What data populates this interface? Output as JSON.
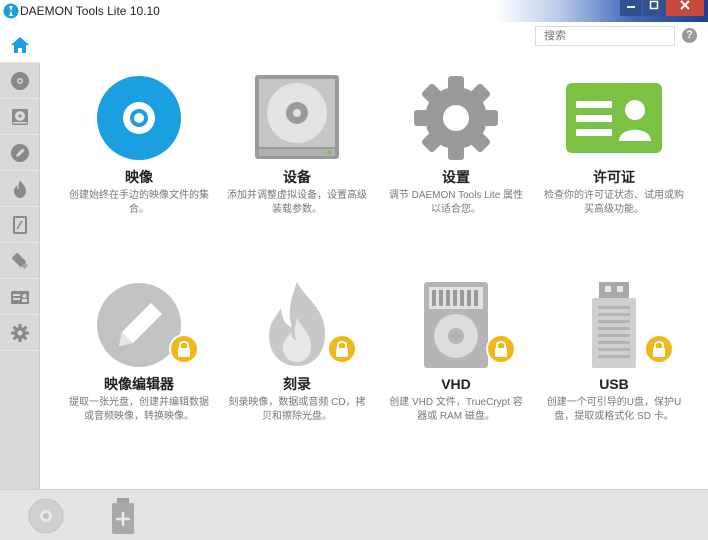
{
  "window": {
    "title": "DAEMON Tools Lite 10.10"
  },
  "search": {
    "placeholder": "搜索"
  },
  "help": {
    "symbol": "?"
  },
  "colors": {
    "accent_blue": "#1a9fe0",
    "lock_yellow": "#f1b81c",
    "license_green": "#7bc143",
    "icon_gray": "#9a9a9a",
    "sidebar_bg": "#d9d9d9"
  },
  "sidebar": {
    "items": [
      {
        "name": "home",
        "icon": "home-icon",
        "active": true
      },
      {
        "name": "images",
        "icon": "disc-icon"
      },
      {
        "name": "virtual-drive",
        "icon": "drive-icon"
      },
      {
        "name": "edit-image",
        "icon": "pencil-icon"
      },
      {
        "name": "burn",
        "icon": "flame-icon"
      },
      {
        "name": "vhd",
        "icon": "vhd-icon"
      },
      {
        "name": "usb",
        "icon": "usb-icon"
      },
      {
        "name": "license",
        "icon": "license-icon"
      },
      {
        "name": "settings",
        "icon": "gear-icon"
      }
    ]
  },
  "tiles": [
    {
      "id": "image",
      "label": "映像",
      "desc": "创建始终在手边的映像文件的集合。",
      "locked": false,
      "icon": "disc-icon"
    },
    {
      "id": "device",
      "label": "设备",
      "desc": "添加并调整虚拟设备，设置高级装载参数。",
      "locked": false,
      "icon": "drive-icon"
    },
    {
      "id": "settings",
      "label": "设置",
      "desc": "调节 DAEMON Tools Lite 属性以适合您。",
      "locked": false,
      "icon": "gear-icon"
    },
    {
      "id": "license",
      "label": "许可证",
      "desc": "检查你的许可证状态、试用或购买高级功能。",
      "locked": false,
      "icon": "license-icon"
    },
    {
      "id": "image-editor",
      "label": "映像编辑器",
      "desc": "提取一张光盘，创建并编辑数据或音频映像，转换映像。",
      "locked": true,
      "icon": "pencil-icon"
    },
    {
      "id": "burn",
      "label": "刻录",
      "desc": "刻录映像，数据或音频 CD，拷贝和擦除光盘。",
      "locked": true,
      "icon": "flame-icon"
    },
    {
      "id": "vhd",
      "label": "VHD",
      "desc": "创建 VHD 文件，TrueCrypt 容器或 RAM 磁盘。",
      "locked": true,
      "icon": "vhd-icon"
    },
    {
      "id": "usb",
      "label": "USB",
      "desc": "创建一个可引导的U盘，保护U盘，提取或格式化 SD 卡。",
      "locked": true,
      "icon": "usb-icon"
    }
  ],
  "bottombar": {
    "items": [
      {
        "name": "quick-mount",
        "icon": "disc-icon"
      },
      {
        "name": "add-drive",
        "icon": "add-icon"
      }
    ]
  }
}
